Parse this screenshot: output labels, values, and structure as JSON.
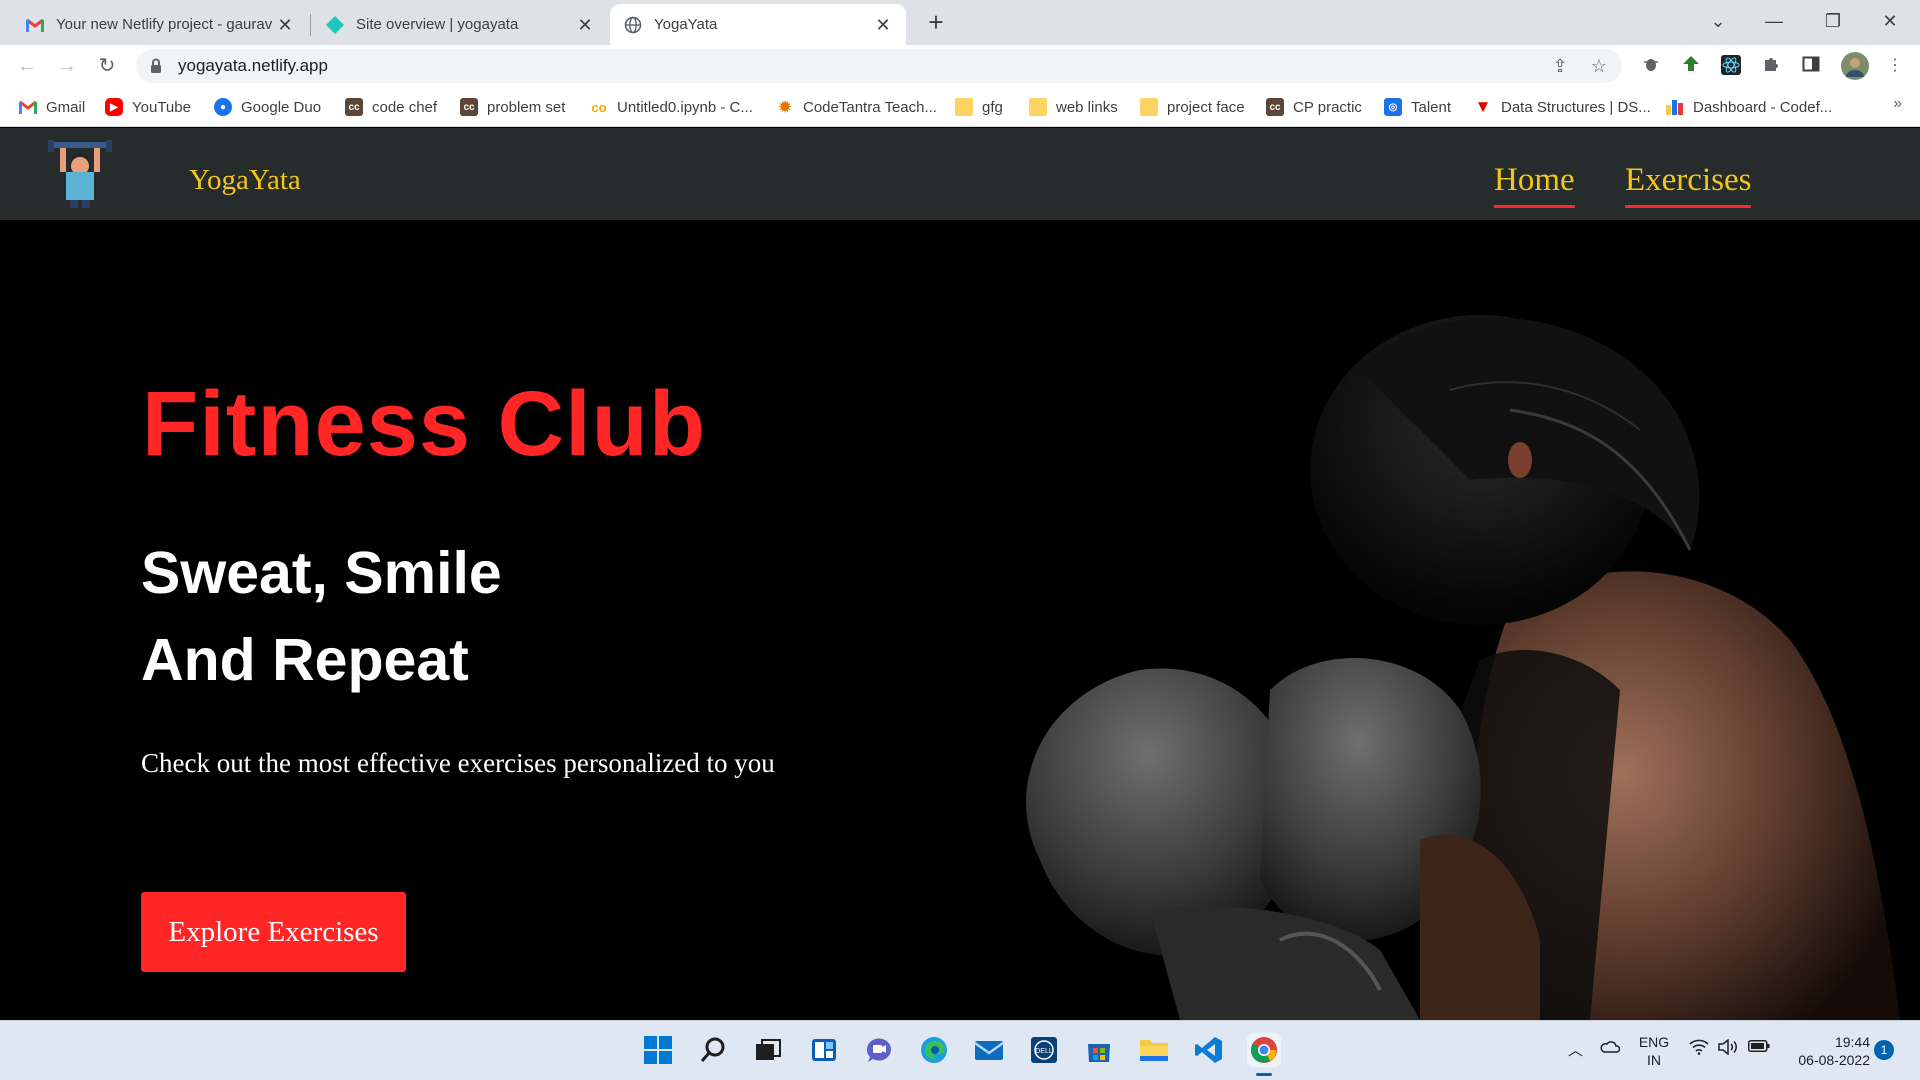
{
  "browser": {
    "tabs": [
      {
        "title": "Your new Netlify project - gaurav",
        "favicon": "gmail-icon",
        "active": false
      },
      {
        "title": "Site overview | yogayata",
        "favicon": "netlify-icon",
        "active": false
      },
      {
        "title": "YogaYata",
        "favicon": "globe-icon",
        "active": true
      }
    ],
    "new_tab_symbol": "+",
    "url": "yogayata.netlify.app",
    "bookmarks": [
      {
        "label": "Gmail",
        "icon": "gmail-icon",
        "color": "#ea4335"
      },
      {
        "label": "YouTube",
        "icon": "youtube-icon",
        "color": "#ff0000"
      },
      {
        "label": "Google Duo",
        "icon": "duo-icon",
        "color": "#1a73e8"
      },
      {
        "label": "code chef",
        "icon": "codechef-icon",
        "color": "#5b4638"
      },
      {
        "label": "problem set",
        "icon": "codechef-icon",
        "color": "#5b4638"
      },
      {
        "label": "Untitled0.ipynb - C...",
        "icon": "colab-icon",
        "color": "#f9ab00"
      },
      {
        "label": "CodeTantra Teach...",
        "icon": "codetantra-icon",
        "color": "#e37400"
      },
      {
        "label": "gfg",
        "icon": "folder-icon",
        "color": "#fcd462"
      },
      {
        "label": "web links",
        "icon": "folder-icon",
        "color": "#fcd462"
      },
      {
        "label": "project face",
        "icon": "folder-icon",
        "color": "#fcd462"
      },
      {
        "label": "CP practic",
        "icon": "codechef-icon",
        "color": "#5b4638"
      },
      {
        "label": "Talent",
        "icon": "talent-icon",
        "color": "#1a73e8"
      },
      {
        "label": "Data Structures | DS...",
        "icon": "vlogo-icon",
        "color": "#e00000"
      },
      {
        "label": "Dashboard - Codef...",
        "icon": "codeforces-icon",
        "color": "#1a73e8"
      }
    ],
    "more_bookmarks": "»"
  },
  "site": {
    "brand": "YogaYata",
    "nav": [
      {
        "label": "Home"
      },
      {
        "label": "Exercises"
      }
    ],
    "hero": {
      "title": "Fitness Club",
      "subtitle_line1": "Sweat, Smile",
      "subtitle_line2": "And Repeat",
      "description": "Check out the most effective exercises personalized to you",
      "cta": "Explore Exercises"
    },
    "colors": {
      "accent_red": "#ff2625",
      "brand_yellow": "#f5c518",
      "nav_bg": "#262b2b"
    }
  },
  "taskbar": {
    "language_line1": "ENG",
    "language_line2": "IN",
    "time": "19:44",
    "date": "06-08-2022",
    "notification_count": "1",
    "apps": [
      "windows-start-icon",
      "search-icon",
      "task-view-icon",
      "widgets-icon",
      "teams-chat-icon",
      "edge-icon",
      "mail-icon",
      "dell-icon",
      "store-icon",
      "file-explorer-icon",
      "vscode-icon",
      "chrome-icon"
    ]
  }
}
